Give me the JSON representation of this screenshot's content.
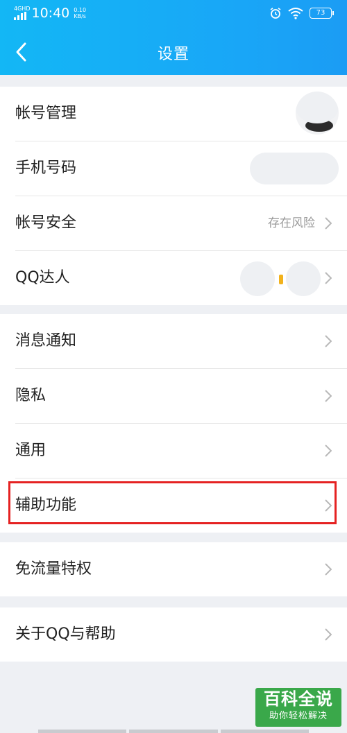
{
  "status_bar": {
    "network": "4G",
    "hd": "HD",
    "time": "10:40",
    "speed_value": "0.10",
    "speed_unit": "KB/s",
    "battery": "73"
  },
  "nav": {
    "title": "设置"
  },
  "group1": [
    {
      "label": "帐号管理"
    },
    {
      "label": "手机号码"
    },
    {
      "label": "帐号安全",
      "value": "存在风险"
    },
    {
      "label": "QQ达人"
    }
  ],
  "group2": [
    {
      "label": "消息通知"
    },
    {
      "label": "隐私"
    },
    {
      "label": "通用"
    },
    {
      "label": "辅助功能"
    }
  ],
  "group3": [
    {
      "label": "免流量特权"
    }
  ],
  "group4": [
    {
      "label": "关于QQ与帮助"
    }
  ],
  "watermark": {
    "title": "百科全说",
    "subtitle": "助你轻松解决"
  },
  "colors": {
    "accent": "#19a6f7",
    "highlight": "#e52222",
    "watermark": "#3aa84a"
  }
}
